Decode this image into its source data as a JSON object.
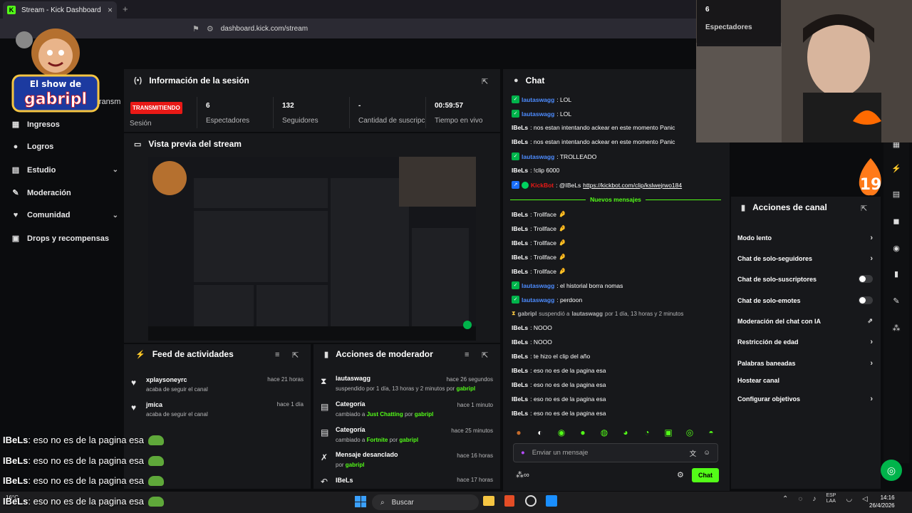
{
  "browser": {
    "tab_title": "Stream - Kick Dashboard",
    "tab_close": "×",
    "new_tab": "+",
    "url": "dashboard.kick.com/stream"
  },
  "logo": {
    "line1": "El show de",
    "line2": "gabripl"
  },
  "nav": {
    "retransm": "retransm",
    "items": [
      {
        "label": "Ingresos",
        "icon": "money-icon"
      },
      {
        "label": "Logros",
        "icon": "trophy-icon"
      },
      {
        "label": "Estudio",
        "icon": "studio-icon",
        "expandable": true
      },
      {
        "label": "Moderación",
        "icon": "wrench-icon"
      },
      {
        "label": "Comunidad",
        "icon": "heart-icon",
        "expandable": true
      },
      {
        "label": "Drops y recompensas",
        "icon": "gift-icon"
      }
    ]
  },
  "session": {
    "title": "Información de la sesión",
    "status": "TRANSMITIENDO",
    "status_label": "Sesión",
    "stats": [
      {
        "value": "6",
        "label": "Espectadores"
      },
      {
        "value": "132",
        "label": "Seguidores"
      },
      {
        "value": "-",
        "label": "Cantidad de suscripciones"
      },
      {
        "value": "00:59:57",
        "label": "Tiempo en vivo"
      }
    ]
  },
  "preview": {
    "title": "Vista previa del stream"
  },
  "feed": {
    "title": "Feed de actividades",
    "items": [
      {
        "name": "xplaysoneyrc",
        "sub": "acaba de seguir el canal",
        "time": "hace 21 horas"
      },
      {
        "name": "jmica",
        "sub": "acaba de seguir el canal",
        "time": "hace 1 día"
      }
    ]
  },
  "mod": {
    "title": "Acciones de moderador",
    "items": [
      {
        "title": "lautaswagg",
        "sub": "suspendido por 1 día, 13 horas y 2 minutos por",
        "who": "gabripl",
        "time": "hace 26 segundos"
      },
      {
        "title": "Categoría",
        "sub": "cambiado a",
        "target": "Just Chatting",
        "por": "por",
        "who": "gabripl",
        "time": "hace 1 minuto"
      },
      {
        "title": "Categoría",
        "sub": "cambiado a",
        "target": "Fortnite",
        "por": "por",
        "who": "gabripl",
        "time": "hace 25 minutos"
      },
      {
        "title": "Mensaje desanclado",
        "sub": "por",
        "who": "gabripl",
        "time": "hace 16 horas"
      },
      {
        "title": "IBeLs",
        "sub": "",
        "who": "",
        "time": "hace 17 horas"
      }
    ]
  },
  "chat": {
    "title": "Chat",
    "new_messages": "Nuevos mensajes",
    "messages": [
      {
        "user": "lautaswagg",
        "text": ": LOL",
        "color": "blue",
        "mod": true
      },
      {
        "user": "lautaswagg",
        "text": ": LOL",
        "color": "blue",
        "mod": true
      },
      {
        "user": "IBeLs",
        "text": ": nos estan intentando ackear en este momento Panic",
        "color": "white"
      },
      {
        "user": "IBeLs",
        "text": ": nos estan intentando ackear en este momento Panic",
        "color": "white"
      },
      {
        "user": "lautaswagg",
        "text": ": TROLLEADO",
        "color": "blue",
        "mod": true
      },
      {
        "user": "IBeLs",
        "text": ": !clip 6000",
        "color": "white"
      },
      {
        "user": "KickBot",
        "text": ": @IBeLs ",
        "link": "https://kickbot.com/clip/kslwejrwo184",
        "color": "red",
        "bot": true
      },
      {
        "user": "IBeLs",
        "text": ": Trollface",
        "color": "white",
        "emote": "🤌"
      },
      {
        "user": "IBeLs",
        "text": ": Trollface",
        "color": "white",
        "emote": "🤌"
      },
      {
        "user": "IBeLs",
        "text": ": Trollface",
        "color": "white",
        "emote": "🤌"
      },
      {
        "user": "IBeLs",
        "text": ": Trollface",
        "color": "white",
        "emote": "🤌"
      },
      {
        "user": "IBeLs",
        "text": ": Trollface",
        "color": "white",
        "emote": "🤌"
      },
      {
        "user": "lautaswagg",
        "text": ": el historial borra nomas",
        "color": "blue",
        "mod": true
      },
      {
        "user": "lautaswagg",
        "text": ": perdoon",
        "color": "blue",
        "mod": true
      },
      {
        "system": true,
        "actor": "gabripl",
        "action": "suspendió a",
        "target": "lautaswagg",
        "rest": "por 1 día, 13 horas y 2 minutos"
      },
      {
        "user": "IBeLs",
        "text": ": NOOO",
        "color": "white"
      },
      {
        "user": "IBeLs",
        "text": ": NOOO",
        "color": "white"
      },
      {
        "user": "IBeLs",
        "text": ": te hizo el clip del año",
        "color": "white"
      },
      {
        "user": "IBeLs",
        "text": ": eso no es de la pagina esa",
        "color": "white"
      },
      {
        "user": "IBeLs",
        "text": ": eso no es de la pagina esa",
        "color": "white"
      },
      {
        "user": "IBeLs",
        "text": ": eso no es de la pagina esa",
        "color": "white"
      },
      {
        "user": "IBeLs",
        "text": ": eso no es de la pagina esa",
        "color": "white"
      }
    ],
    "input_placeholder": "Enviar un mensaje",
    "send_label": "Chat"
  },
  "channel_actions": {
    "title": "Acciones de canal",
    "items": [
      {
        "label": "Modo lento",
        "kind": "arrow"
      },
      {
        "label": "Chat de solo-seguidores",
        "kind": "arrow"
      },
      {
        "label": "Chat de solo-suscriptores",
        "kind": "toggle"
      },
      {
        "label": "Chat de solo-emotes",
        "kind": "toggle"
      },
      {
        "label": "Moderación del chat con IA",
        "kind": "external"
      },
      {
        "label": "Restricción de edad",
        "kind": "arrow"
      },
      {
        "label": "Palabras baneadas",
        "kind": "arrow"
      },
      {
        "label": "Hostear canal",
        "kind": "none"
      },
      {
        "label": "Configurar objetivos",
        "kind": "arrow"
      }
    ]
  },
  "webcam": {
    "viewers_value": "6",
    "viewers_label": "Espectadores",
    "badge": "19"
  },
  "overlay_chat": [
    {
      "user": "IBeLs",
      "text": ": eso no es de la pagina esa"
    },
    {
      "user": "IBeLs",
      "text": ": eso no es de la pagina esa"
    },
    {
      "user": "IBeLs",
      "text": ": eso no es de la pagina esa"
    },
    {
      "user": "IBeLs",
      "text": ": eso no es de la pagina esa"
    }
  ],
  "taskbar": {
    "search": "Buscar",
    "weather": "16°C",
    "lang1": "ESP",
    "lang2": "LAA",
    "time": "14:16",
    "date": "26/4/2026"
  },
  "colors": {
    "accent": "#53fc18",
    "live": "#e91916",
    "panel": "#17181b"
  }
}
